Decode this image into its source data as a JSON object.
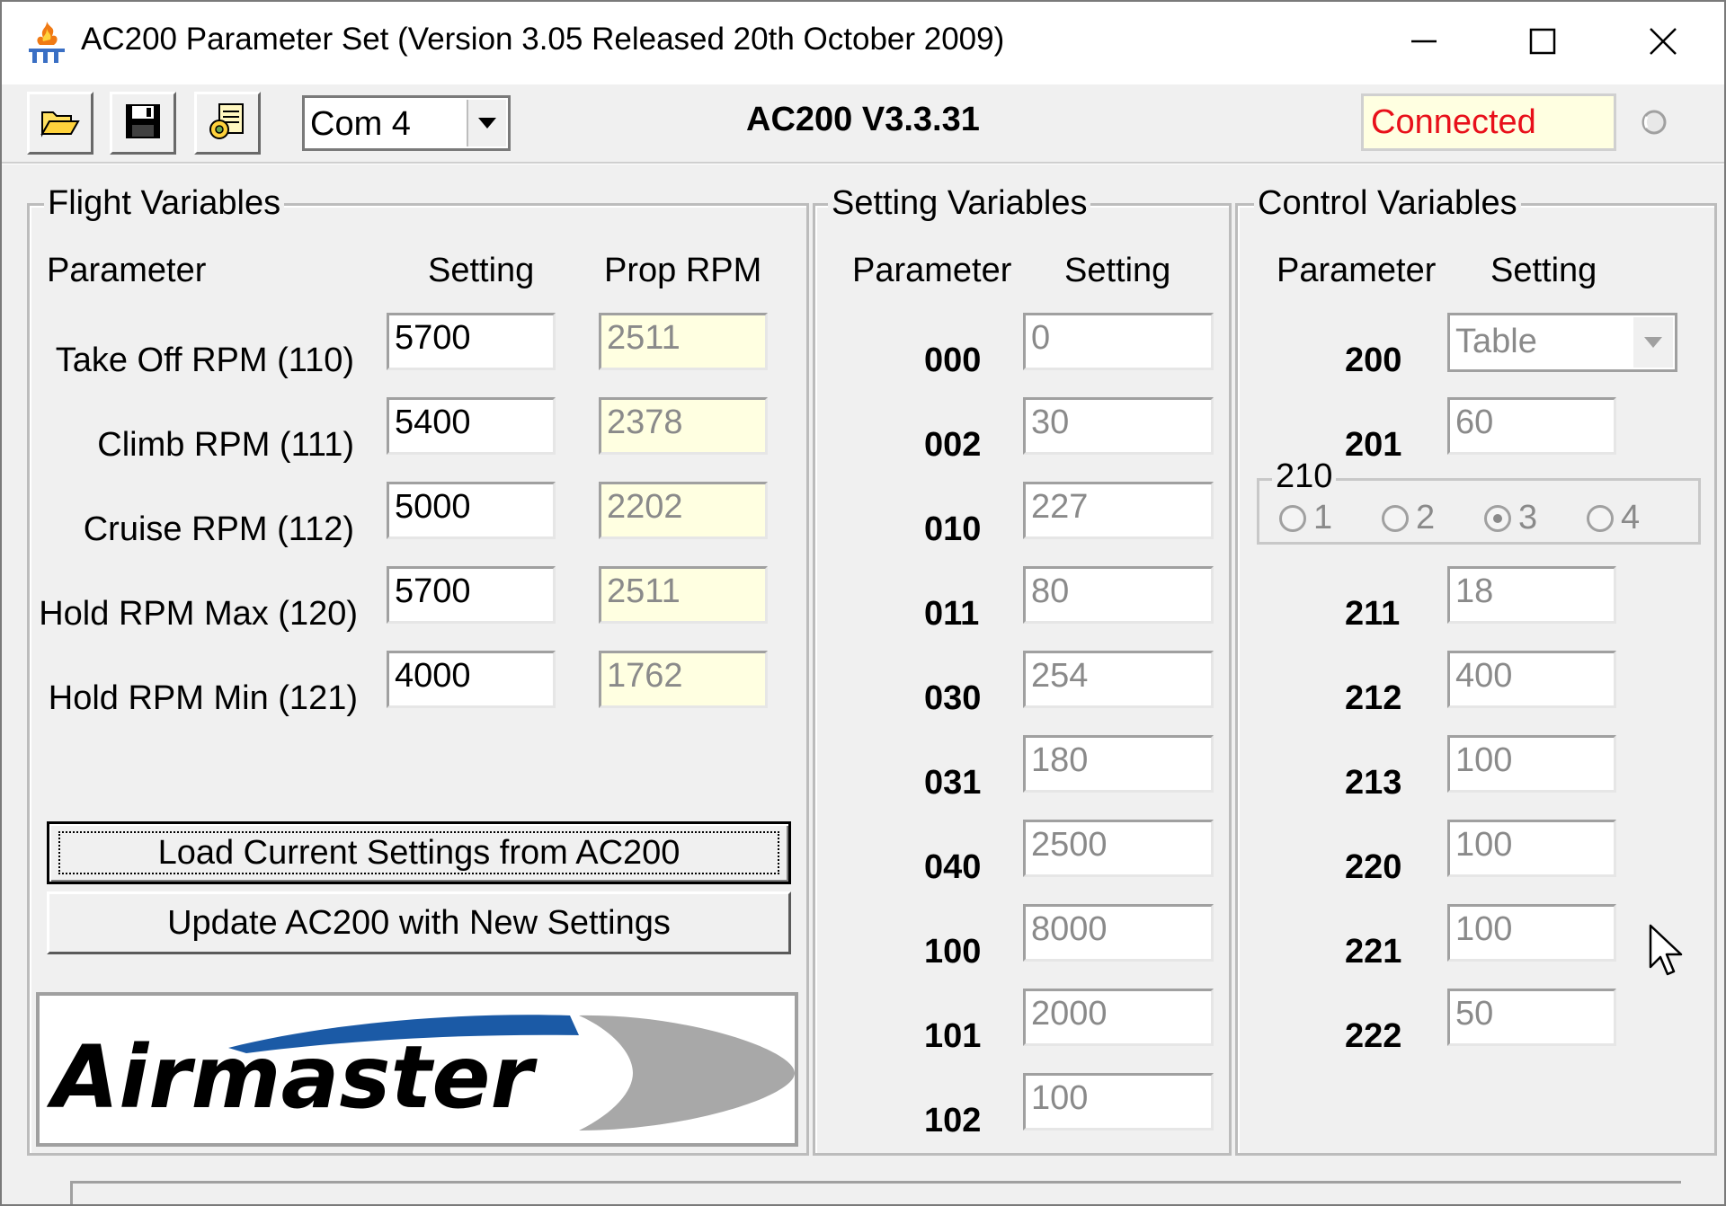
{
  "window": {
    "title": "AC200 Parameter Set (Version 3.05 Released 20th October 2009)"
  },
  "toolbar": {
    "port_value": "Com 4",
    "device_version": "AC200 V3.3.31",
    "status": "Connected",
    "status_color": "#e8101a"
  },
  "flight": {
    "title": "Flight Variables",
    "headers": {
      "parameter": "Parameter",
      "setting": "Setting",
      "prop_rpm": "Prop RPM"
    },
    "rows": [
      {
        "label": "Take Off RPM (110)",
        "setting": "5700",
        "prop": "2511"
      },
      {
        "label": "Climb RPM (111)",
        "setting": "5400",
        "prop": "2378"
      },
      {
        "label": "Cruise RPM (112)",
        "setting": "5000",
        "prop": "2202"
      },
      {
        "label": "Hold RPM Max (120)",
        "setting": "5700",
        "prop": "2511"
      },
      {
        "label": "Hold RPM Min (121)",
        "setting": "4000",
        "prop": "1762"
      }
    ],
    "load_button": "Load Current Settings from AC200",
    "update_button": "Update AC200 with New Settings"
  },
  "logo": {
    "text": "Airmaster",
    "brand_blue": "#1b5aa6"
  },
  "setting": {
    "title": "Setting Variables",
    "headers": {
      "parameter": "Parameter",
      "setting": "Setting"
    },
    "rows": [
      {
        "param": "000",
        "value": "0"
      },
      {
        "param": "002",
        "value": "30"
      },
      {
        "param": "010",
        "value": "227"
      },
      {
        "param": "011",
        "value": "80"
      },
      {
        "param": "030",
        "value": "254"
      },
      {
        "param": "031",
        "value": "180"
      },
      {
        "param": "040",
        "value": "2500"
      },
      {
        "param": "100",
        "value": "8000"
      },
      {
        "param": "101",
        "value": "2000"
      },
      {
        "param": "102",
        "value": "100"
      }
    ]
  },
  "control": {
    "title": "Control Variables",
    "headers": {
      "parameter": "Parameter",
      "setting": "Setting"
    },
    "p200": {
      "param": "200",
      "value": "Table"
    },
    "p201": {
      "param": "201",
      "value": "60"
    },
    "radio": {
      "title": "210",
      "options": [
        "1",
        "2",
        "3",
        "4"
      ],
      "selected": "3"
    },
    "rows": [
      {
        "param": "211",
        "value": "18"
      },
      {
        "param": "212",
        "value": "400"
      },
      {
        "param": "213",
        "value": "100"
      },
      {
        "param": "220",
        "value": "100"
      },
      {
        "param": "221",
        "value": "100"
      },
      {
        "param": "222",
        "value": "50"
      }
    ]
  }
}
